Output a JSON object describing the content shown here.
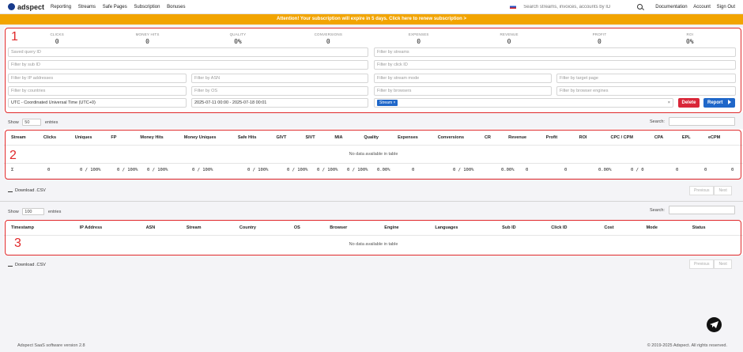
{
  "brand": {
    "name": "adspect"
  },
  "nav": [
    "Reporting",
    "Streams",
    "Safe Pages",
    "Subscription",
    "Bonuses"
  ],
  "search_placeholder": "Search streams, invoices, accounts by ID",
  "top_links": [
    "Documentation",
    "Account",
    "Sign Out"
  ],
  "alert": "Attention! Your subscription will expire in 5 days. Click here to renew subscription >",
  "stats": [
    {
      "label": "CLICKS",
      "value": "0"
    },
    {
      "label": "MONEY HITS",
      "value": "0"
    },
    {
      "label": "QUALITY",
      "value": "0%"
    },
    {
      "label": "CONVERSIONS",
      "value": "0"
    },
    {
      "label": "EXPENSES",
      "value": "0"
    },
    {
      "label": "REVENUE",
      "value": "0"
    },
    {
      "label": "PROFIT",
      "value": "0"
    },
    {
      "label": "ROI",
      "value": "0%"
    }
  ],
  "filters": {
    "saved_query": "Saved query ID",
    "streams": "Filter by streams",
    "sub_id": "Filter by sub ID",
    "click_id": "Filter by click ID",
    "ip": "Filter by IP addresses",
    "asn": "Filter by ASN",
    "stream_mode": "Filter by stream mode",
    "target_page": "Filter by target page",
    "countries": "Filter by countries",
    "os": "Filter by OS",
    "browsers": "Filter by browsers",
    "browser_engines": "Filter by browser engines",
    "timezone": "UTC - Coordinated Universal Time (UTC+0)",
    "date_range": "2025-07-11 00:00 - 2025-07-18 00:01",
    "group_tag": "Stream ×",
    "clear": "×"
  },
  "buttons": {
    "delete": "Delete",
    "report": "Report"
  },
  "labels": {
    "show": "Show",
    "entries": "entries",
    "search": "Search:",
    "download": "Download .CSV",
    "previous": "Previous",
    "next": "Next",
    "no_data": "No data available in table"
  },
  "table1": {
    "page_size": "50",
    "columns": [
      "Stream",
      "Clicks",
      "Uniques",
      "FP",
      "Money Hits",
      "Money Uniques",
      "Safe Hits",
      "GIVT",
      "SIVT",
      "MIA",
      "Quality",
      "Expenses",
      "Conversions",
      "CR",
      "Revenue",
      "Profit",
      "ROI",
      "CPC / CPM",
      "CPA",
      "EPL",
      "eCPM"
    ],
    "totals": [
      "Σ",
      "0",
      "0 / 100%",
      "0 / 100%",
      "0 / 100%",
      "0 / 100%",
      "0 / 100%",
      "0 / 100%",
      "0 / 100%",
      "0 / 100%",
      "0.00%",
      "0",
      "0 / 100%",
      "0.00%",
      "0",
      "0",
      "0.00%",
      "0 / 0",
      "0",
      "0",
      "0"
    ]
  },
  "table2": {
    "page_size": "100",
    "columns": [
      "Timestamp",
      "IP Address",
      "ASN",
      "Stream",
      "Country",
      "OS",
      "Browser",
      "Engine",
      "Languages",
      "Sub ID",
      "Click ID",
      "Cost",
      "Mode",
      "Status"
    ]
  },
  "annotations": [
    "1",
    "2",
    "3"
  ],
  "footer": {
    "left": "Adspect SaaS software version 2.8",
    "right": "© 2019-2025 Adspect. All rights reserved."
  }
}
